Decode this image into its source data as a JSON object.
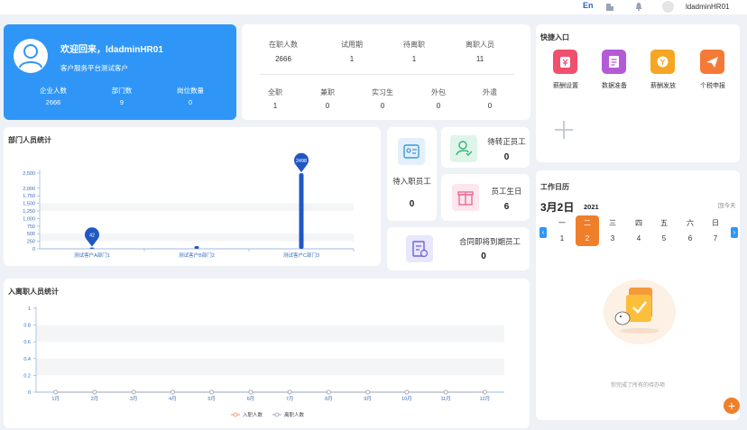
{
  "topbar": {
    "lang": "En",
    "username": "ldadminHR01",
    "icons": [
      "building-icon",
      "bell-icon",
      "avatar-icon"
    ]
  },
  "welcome": {
    "title": "欢迎回来，ldadminHR01",
    "subtitle": "客户服务平台测试客户",
    "stats": [
      {
        "label": "企业人数",
        "value": "2666"
      },
      {
        "label": "部门数",
        "value": "9"
      },
      {
        "label": "岗位数量",
        "value": "0"
      }
    ]
  },
  "staff_status": {
    "row1": [
      {
        "label": "在职人数",
        "value": "2666"
      },
      {
        "label": "试用期",
        "value": "1"
      },
      {
        "label": "待离职",
        "value": "1"
      },
      {
        "label": "离职人员",
        "value": "11"
      }
    ],
    "row2": [
      {
        "label": "全职",
        "value": "1"
      },
      {
        "label": "兼职",
        "value": "0"
      },
      {
        "label": "实习生",
        "value": "0"
      },
      {
        "label": "外包",
        "value": "0"
      },
      {
        "label": "外遣",
        "value": "0"
      }
    ]
  },
  "tiles": {
    "pending_entry": {
      "label": "待入职员工",
      "value": "0"
    },
    "pending_regular": {
      "label": "待转正员工",
      "value": "0"
    },
    "birthday": {
      "label": "员工生日",
      "value": "6"
    },
    "contract_expiring": {
      "label": "合同即将到期员工",
      "value": "0"
    }
  },
  "quick_access": {
    "title": "快捷入口",
    "items": [
      {
        "label": "薪酬设置",
        "icon": "salary-settings-icon",
        "color": "#f0506e"
      },
      {
        "label": "数据准备",
        "icon": "data-prep-icon",
        "color": "#b55ad6"
      },
      {
        "label": "薪酬发放",
        "icon": "salary-pay-icon",
        "color": "#f5a623"
      },
      {
        "label": "个税申报",
        "icon": "tax-report-icon",
        "color": "#f47b37"
      }
    ],
    "add_icon": "plus-icon"
  },
  "calendar": {
    "title": "工作日历",
    "date": "3月2日",
    "year": "2021",
    "today_link": "回今天",
    "weekdays": [
      "一",
      "二",
      "三",
      "四",
      "五",
      "六",
      "日"
    ],
    "days": [
      "1",
      "2",
      "3",
      "4",
      "5",
      "6",
      "7"
    ],
    "selected_index": 1,
    "empty_text": "你完成了所有的待办项"
  },
  "colors": {
    "primary": "#2f96f7",
    "accent_orange": "#f07f2a",
    "bar": "#1f57c3"
  },
  "chart_data": [
    {
      "type": "bar",
      "title": "部门人员统计",
      "categories": [
        "测试客户A部门1",
        "测试客户B部门2",
        "测试客户C部门3"
      ],
      "values": [
        42,
        90,
        2498
      ],
      "data_labels": [
        "42",
        "",
        "2498"
      ],
      "ylim": [
        0,
        2500
      ],
      "yticks": [
        "0",
        "250",
        "500",
        "750",
        "1,000",
        "1,250",
        "1,500",
        "1,750",
        "2,000",
        "2,500"
      ],
      "xlabel": "",
      "ylabel": ""
    },
    {
      "type": "line",
      "title": "入离职人员统计",
      "categories": [
        "1月",
        "2月",
        "3月",
        "4月",
        "5月",
        "6月",
        "7月",
        "8月",
        "9月",
        "10月",
        "11月",
        "12月"
      ],
      "series": [
        {
          "name": "入职人数",
          "values": [
            0,
            0,
            0,
            0,
            0,
            0,
            0,
            0,
            0,
            0,
            0,
            0
          ],
          "color": "#f08a6e"
        },
        {
          "name": "离职人数",
          "values": [
            0,
            0,
            0,
            0,
            0,
            0,
            0,
            0,
            0,
            0,
            0,
            0
          ],
          "color": "#9aa3b5"
        }
      ],
      "ylim": [
        0,
        1
      ],
      "yticks": [
        "0",
        "0.2",
        "0.4",
        "0.6",
        "0.8",
        "1"
      ],
      "legend": "bottom"
    }
  ]
}
